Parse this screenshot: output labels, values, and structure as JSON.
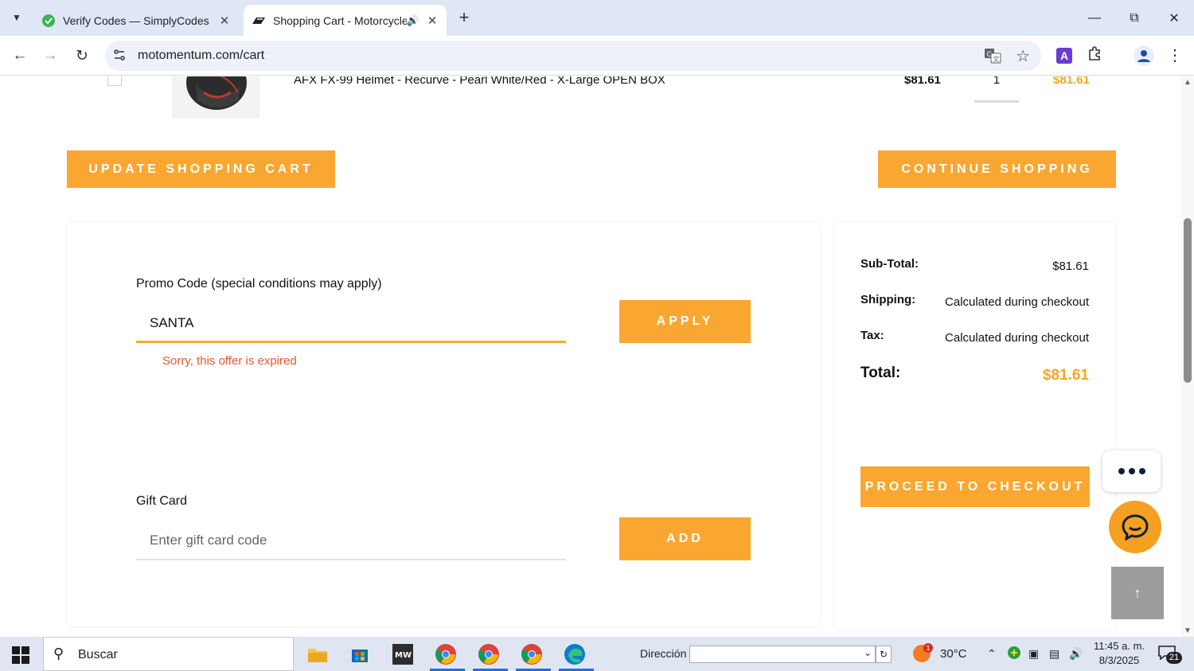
{
  "browser": {
    "tabs": [
      {
        "title": "Verify Codes — SimplyCodes",
        "active": false
      },
      {
        "title": "Shopping Cart - Motorcycle",
        "active": true
      }
    ],
    "url": "motomentum.com/cart"
  },
  "cart": {
    "item": {
      "name": "AFX FX-99 Helmet - Recurve - Pearl White/Red - X-Large OPEN BOX",
      "price": "$81.61",
      "quantity": "1",
      "line_total": "$81.61"
    },
    "update_button": "Update Shopping Cart",
    "continue_button": "Continue Shopping"
  },
  "promo": {
    "label": "Promo Code (special conditions may apply)",
    "value": "SANTA",
    "apply_button": "Apply",
    "error": "Sorry, this offer is expired"
  },
  "gift_card": {
    "label": "Gift Card",
    "placeholder": "Enter gift card code",
    "add_button": "Add"
  },
  "summary": {
    "subtotal_label": "Sub-Total:",
    "subtotal_value": "$81.61",
    "shipping_label": "Shipping:",
    "shipping_value": "Calculated during checkout",
    "tax_label": "Tax:",
    "tax_value": "Calculated during checkout",
    "total_label": "Total:",
    "total_value": "$81.61",
    "checkout_button": "Proceed to Checkout"
  },
  "taskbar": {
    "search_placeholder": "Buscar",
    "address_label": "Dirección",
    "weather_badge": "1",
    "temperature": "30°C",
    "time": "11:45 a. m.",
    "date": "8/3/2025",
    "notifications": "21"
  },
  "colors": {
    "accent": "#f9a730",
    "error": "#e4572e",
    "total": "#f5a623"
  }
}
